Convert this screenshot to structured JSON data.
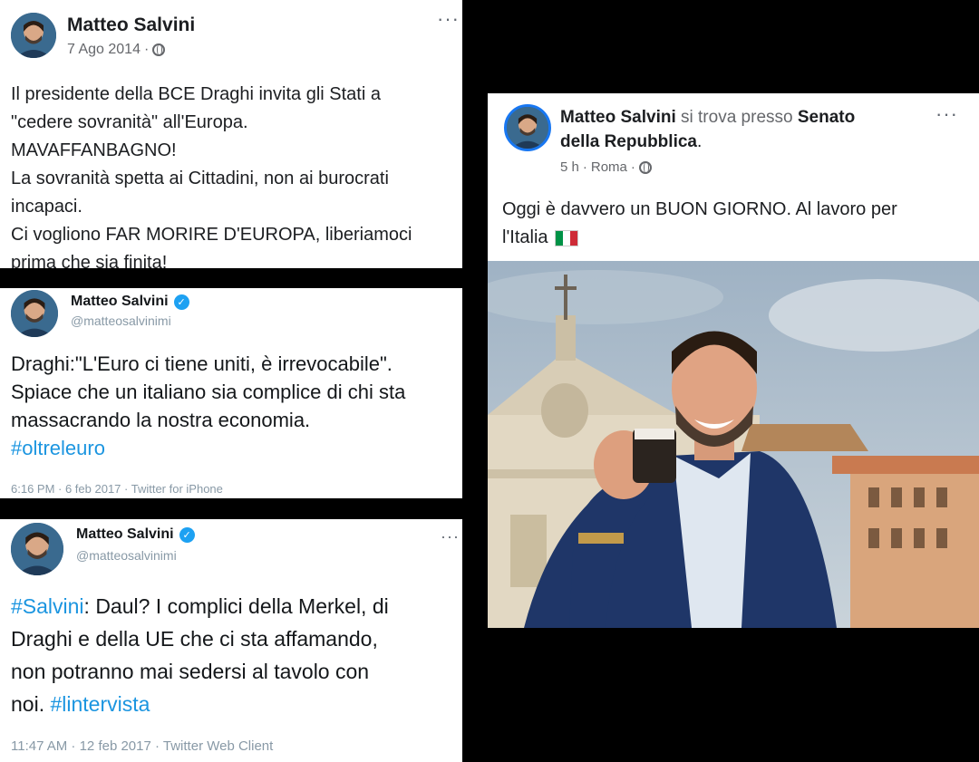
{
  "post1": {
    "author": "Matteo Salvini",
    "date": "7 Ago 2014",
    "dot": "·",
    "more": "···",
    "lines": [
      "Il presidente della BCE Draghi invita gli Stati a",
      "\"cedere sovranità\" all'Europa.",
      "MAVAFFANBAGNO!",
      "La sovranità spetta ai Cittadini, non ai burocrati",
      "incapaci.",
      "Ci vogliono FAR MORIRE D'EUROPA, liberiamoci",
      "prima che sia finita!"
    ]
  },
  "tweet1": {
    "author": "Matteo Salvini",
    "handle": "@matteosalvinimi",
    "lines": [
      "Draghi:\"L'Euro ci tiene uniti, è irrevocabile\".",
      "Spiace che un italiano sia complice di chi sta",
      "massacrando la nostra economia."
    ],
    "hashtag": "#oltreleuro",
    "footer": "6:16 PM · 6 feb 2017 · Twitter for iPhone"
  },
  "tweet2": {
    "author": "Matteo Salvini",
    "handle": "@matteosalvinimi",
    "more": "···",
    "hashtag1": "#Salvini",
    "line1_rest": ": Daul? I complici della Merkel, di",
    "line2": "Draghi e della UE che ci sta affamando,",
    "line3": "non potranno mai sedersi al tavolo con",
    "line4_start": "noi. ",
    "hashtag2": "#lintervista",
    "footer": "11:47 AM · 12 feb 2017 · Twitter Web Client"
  },
  "post2": {
    "author": "Matteo Salvini",
    "location_prefix": "si trova presso",
    "location_name_1": "Senato",
    "location_name_2": "della Repubblica",
    "period": ".",
    "time": "5 h",
    "place": "Roma",
    "dot": "·",
    "more": "···",
    "line1": "Oggi è davvero un BUON GIORNO. Al lavoro per",
    "line2": "l'Italia"
  },
  "colors": {
    "facebook_text": "#1c1e21",
    "meta_gray": "#65676b",
    "twitter_blue": "#1da1f2",
    "hashtag": "#1b95e0"
  }
}
